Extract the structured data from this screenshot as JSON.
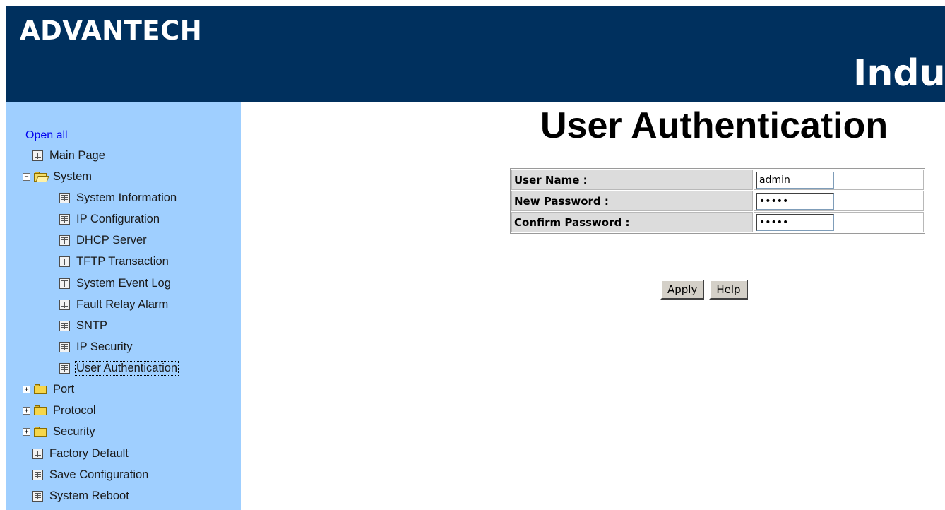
{
  "header": {
    "logo_text": "ADVANTECH",
    "banner_text": "Indu",
    "background_color": "#00305e"
  },
  "sidebar": {
    "background_color": "#9fcfff",
    "open_all_label": "Open all",
    "items": [
      {
        "label": "Main Page",
        "type": "page",
        "icon": "page-icon"
      },
      {
        "label": "System",
        "type": "folder",
        "state": "expanded",
        "icon": "folder-open-icon"
      },
      {
        "label": "System Information",
        "type": "page",
        "icon": "page-icon"
      },
      {
        "label": "IP Configuration",
        "type": "page",
        "icon": "page-icon"
      },
      {
        "label": "DHCP Server",
        "type": "page",
        "icon": "page-icon"
      },
      {
        "label": "TFTP Transaction",
        "type": "page",
        "icon": "page-icon"
      },
      {
        "label": "System Event Log",
        "type": "page",
        "icon": "page-icon"
      },
      {
        "label": "Fault Relay Alarm",
        "type": "page",
        "icon": "page-icon"
      },
      {
        "label": "SNTP",
        "type": "page",
        "icon": "page-icon"
      },
      {
        "label": "IP Security",
        "type": "page",
        "icon": "page-icon"
      },
      {
        "label": "User Authentication",
        "type": "page",
        "icon": "page-icon",
        "selected": true
      },
      {
        "label": "Port",
        "type": "folder",
        "state": "collapsed",
        "icon": "folder-icon"
      },
      {
        "label": "Protocol",
        "type": "folder",
        "state": "collapsed",
        "icon": "folder-icon"
      },
      {
        "label": "Security",
        "type": "folder",
        "state": "collapsed",
        "icon": "folder-icon"
      },
      {
        "label": "Factory Default",
        "type": "page",
        "icon": "page-icon"
      },
      {
        "label": "Save Configuration",
        "type": "page",
        "icon": "page-icon"
      },
      {
        "label": "System Reboot",
        "type": "page",
        "icon": "page-icon"
      }
    ]
  },
  "main": {
    "title": "User Authentication",
    "form": {
      "user_name": {
        "label": "User Name :",
        "value": "admin"
      },
      "new_password": {
        "label": "New Password :",
        "value": "admin"
      },
      "confirm_password": {
        "label": "Confirm Password :",
        "value": "admin"
      }
    },
    "buttons": {
      "apply": "Apply",
      "help": "Help"
    }
  }
}
